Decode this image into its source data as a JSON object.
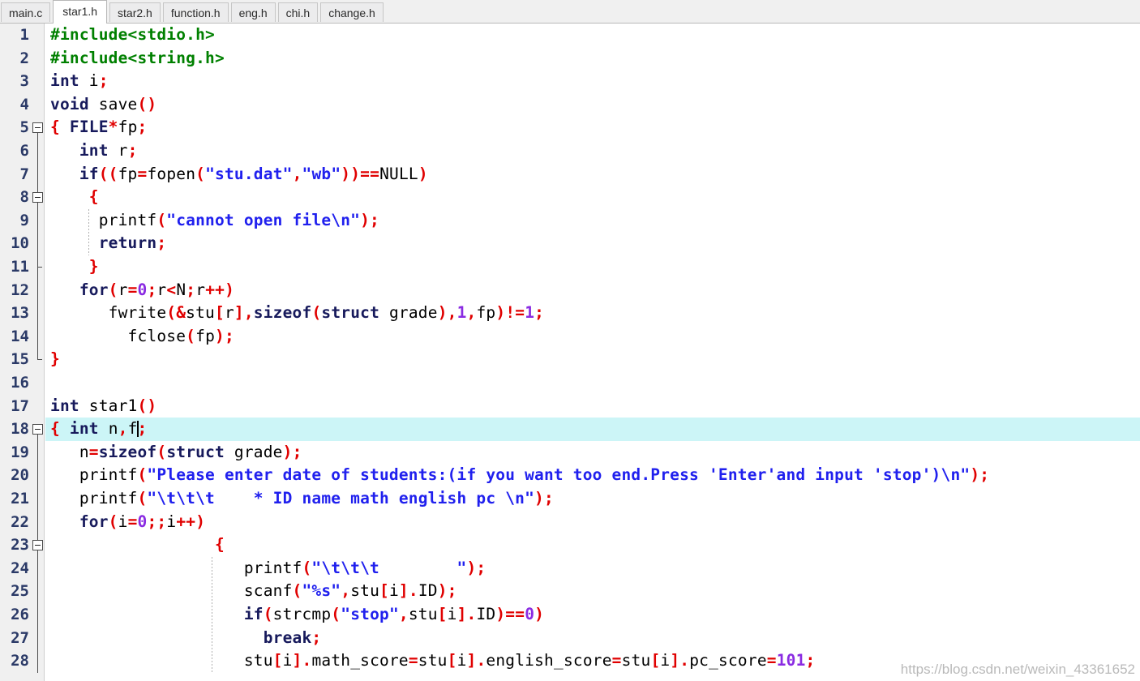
{
  "tabs": [
    {
      "label": "main.c",
      "active": false
    },
    {
      "label": "star1.h",
      "active": true
    },
    {
      "label": "star2.h",
      "active": false
    },
    {
      "label": "function.h",
      "active": false
    },
    {
      "label": "eng.h",
      "active": false
    },
    {
      "label": "chi.h",
      "active": false
    },
    {
      "label": "change.h",
      "active": false
    }
  ],
  "editor": {
    "active_file": "star1.h",
    "current_line": 18,
    "caret_after_text": "{ int n,f",
    "first_line": 1,
    "last_line": 28,
    "colors": {
      "preprocessor": "#008000",
      "keyword": "#171a5c",
      "string": "#2020ee",
      "operator": "#e00000",
      "number": "#8a2be2",
      "identifier": "#000000",
      "current_line_highlight": "#ccf5f7",
      "gutter_background": "#f0f0f0",
      "line_number": "#2b3a67",
      "editor_background": "#ffffff"
    },
    "fold_markers": [
      5,
      8,
      18,
      23
    ],
    "lines": [
      {
        "n": 1,
        "text": "#include<stdio.h>"
      },
      {
        "n": 2,
        "text": "#include<string.h>"
      },
      {
        "n": 3,
        "text": "int i;"
      },
      {
        "n": 4,
        "text": "void save()"
      },
      {
        "n": 5,
        "text": "{ FILE*fp;"
      },
      {
        "n": 6,
        "text": "   int r;"
      },
      {
        "n": 7,
        "text": "   if((fp=fopen(\"stu.dat\",\"wb\"))==NULL)"
      },
      {
        "n": 8,
        "text": "    {"
      },
      {
        "n": 9,
        "text": "     printf(\"cannot open file\\n\");"
      },
      {
        "n": 10,
        "text": "     return;"
      },
      {
        "n": 11,
        "text": "    }"
      },
      {
        "n": 12,
        "text": "   for(r=0;r<N;r++)"
      },
      {
        "n": 13,
        "text": "      fwrite(&stu[r],sizeof(struct grade),1,fp)!=1;"
      },
      {
        "n": 14,
        "text": "        fclose(fp);"
      },
      {
        "n": 15,
        "text": "}"
      },
      {
        "n": 16,
        "text": ""
      },
      {
        "n": 17,
        "text": "int star1()"
      },
      {
        "n": 18,
        "text": "{ int n,f;"
      },
      {
        "n": 19,
        "text": "   n=sizeof(struct grade);"
      },
      {
        "n": 20,
        "text": "   printf(\"Please enter date of students:(if you want too end.Press 'Enter'and input 'stop')\\n\");"
      },
      {
        "n": 21,
        "text": "   printf(\"\\t\\t\\t    * ID name math english pc \\n\");"
      },
      {
        "n": 22,
        "text": "   for(i=0;;i++)"
      },
      {
        "n": 23,
        "text": "                 {"
      },
      {
        "n": 24,
        "text": "                    printf(\"\\t\\t\\t        \");"
      },
      {
        "n": 25,
        "text": "                    scanf(\"%s\",stu[i].ID);"
      },
      {
        "n": 26,
        "text": "                    if(strcmp(\"stop\",stu[i].ID)==0)"
      },
      {
        "n": 27,
        "text": "                      break;"
      },
      {
        "n": 28,
        "text": "                    stu[i].math_score=stu[i].english_score=stu[i].pc_score=101;"
      }
    ]
  },
  "watermark": {
    "text": "https://blog.csdn.net/weixin_43361652"
  }
}
